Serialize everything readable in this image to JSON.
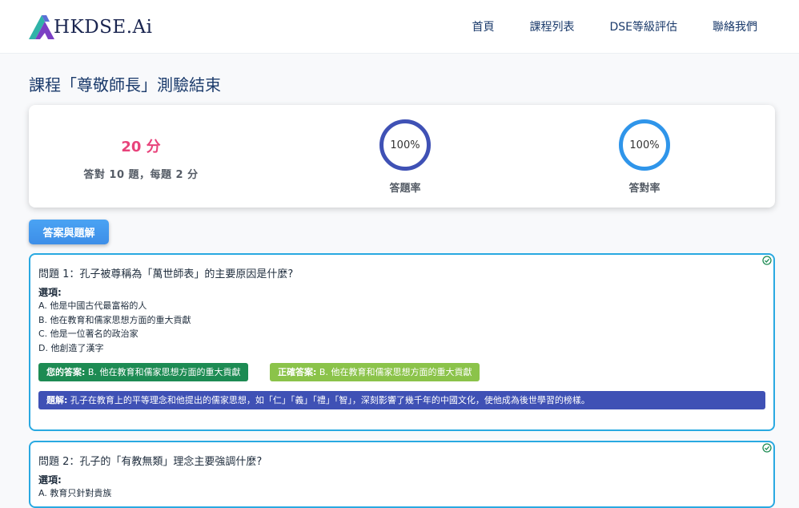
{
  "nav": {
    "brand": "HKDSE.Ai",
    "links": [
      "首頁",
      "課程列表",
      "DSE等級評估",
      "聯絡我們"
    ]
  },
  "page": {
    "title": "課程「尊敬師長」測驗結束"
  },
  "summary": {
    "score": "20 分",
    "detail": "答對 10 題，每題 2 分",
    "answered_rate": {
      "value": "100%",
      "label": "答題率"
    },
    "correct_rate": {
      "value": "100%",
      "label": "答對率"
    }
  },
  "answers_button": "答案與題解",
  "questions": [
    {
      "title": "問題 1：孔子被尊稱為「萬世師表」的主要原因是什麼?",
      "options_label": "選項:",
      "options": [
        "A. 他是中國古代最富裕的人",
        "B. 他在教育和儒家思想方面的重大貢獻",
        "C. 他是一位著名的政治家",
        "D. 他創造了漢字"
      ],
      "your_answer_label": "您的答案:",
      "your_answer": "B. 他在教育和儒家思想方面的重大貢獻",
      "correct_answer_label": "正確答案:",
      "correct_answer": "B. 他在教育和儒家思想方面的重大貢獻",
      "explanation_label": "題解:",
      "explanation": "孔子在教育上的平等理念和他提出的儒家思想，如「仁」「義」「禮」「智」，深刻影響了幾千年的中國文化，使他成為後世學習的榜樣。"
    },
    {
      "title": "問題 2：孔子的「有教無類」理念主要強調什麼?",
      "options_label": "選項:",
      "options": [
        "A. 教育只針對貴族"
      ]
    }
  ],
  "colors": {
    "accent": "#3f51b5",
    "score": "#e8437b",
    "card_border": "#29a9e1",
    "your_answer": "#1d8b53",
    "correct_answer": "#8bc34a"
  }
}
